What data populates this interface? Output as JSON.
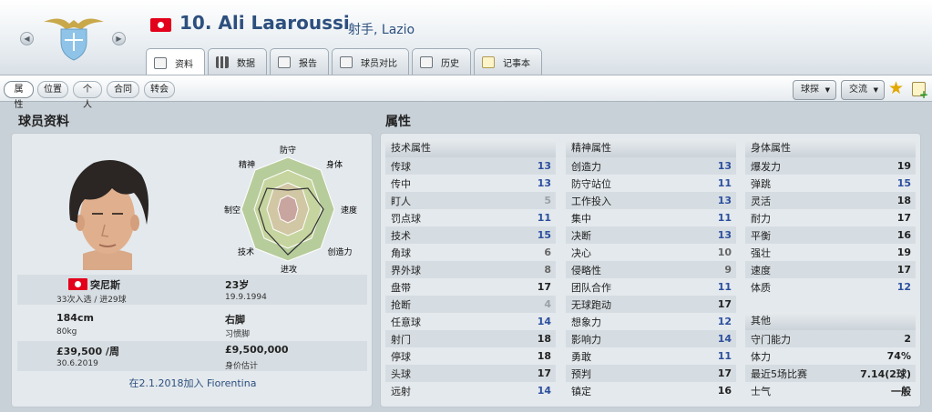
{
  "header": {
    "name": "10. Ali Laaroussi",
    "subtitle": "射手, Lazio"
  },
  "tabs": [
    {
      "label": "资料",
      "icon": "profile-icon"
    },
    {
      "label": "数据",
      "icon": "stats-icon"
    },
    {
      "label": "报告",
      "icon": "report-icon"
    },
    {
      "label": "球员对比",
      "icon": "compare-icon"
    },
    {
      "label": "历史",
      "icon": "history-icon"
    },
    {
      "label": "记事本",
      "icon": "notebook-icon"
    }
  ],
  "subtabs": [
    "属性",
    "位置",
    "个人",
    "合同",
    "转会"
  ],
  "toolbar": {
    "scout_label": "球探",
    "interact_label": "交流"
  },
  "profile": {
    "title": "球员资料",
    "radar_labels": [
      "防守",
      "身体",
      "速度",
      "创造力",
      "进攻",
      "技术",
      "制空",
      "精神"
    ],
    "nationality": "突尼斯",
    "caps": "33次入选 / 进29球",
    "age": "23岁",
    "dob": "19.9.1994",
    "height": "184cm",
    "weight": "80kg",
    "foot": "右脚",
    "foot_label": "习惯脚",
    "wage": "£39,500 /周",
    "contract_end": "30.6.2019",
    "value": "£9,500,000",
    "value_label": "身价估计",
    "joined": "在2.1.2018加入 Fiorentina"
  },
  "attributes": {
    "title": "属性",
    "technical": {
      "header": "技术属性",
      "rows": [
        [
          "传球",
          "13"
        ],
        [
          "传中",
          "13"
        ],
        [
          "盯人",
          "5"
        ],
        [
          "罚点球",
          "11"
        ],
        [
          "技术",
          "15"
        ],
        [
          "角球",
          "6"
        ],
        [
          "界外球",
          "8"
        ],
        [
          "盘带",
          "17"
        ],
        [
          "抢断",
          "4"
        ],
        [
          "任意球",
          "14"
        ],
        [
          "射门",
          "18"
        ],
        [
          "停球",
          "18"
        ],
        [
          "头球",
          "17"
        ],
        [
          "远射",
          "14"
        ]
      ]
    },
    "mental": {
      "header": "精神属性",
      "rows": [
        [
          "创造力",
          "13"
        ],
        [
          "防守站位",
          "11"
        ],
        [
          "工作投入",
          "13"
        ],
        [
          "集中",
          "11"
        ],
        [
          "决断",
          "13"
        ],
        [
          "决心",
          "10"
        ],
        [
          "侵略性",
          "9"
        ],
        [
          "团队合作",
          "11"
        ],
        [
          "无球跑动",
          "17"
        ],
        [
          "想象力",
          "12"
        ],
        [
          "影响力",
          "14"
        ],
        [
          "勇敢",
          "11"
        ],
        [
          "预判",
          "17"
        ],
        [
          "镇定",
          "16"
        ]
      ]
    },
    "physical": {
      "header": "身体属性",
      "rows": [
        [
          "爆发力",
          "19"
        ],
        [
          "弹跳",
          "15"
        ],
        [
          "灵活",
          "18"
        ],
        [
          "耐力",
          "17"
        ],
        [
          "平衡",
          "16"
        ],
        [
          "强壮",
          "19"
        ],
        [
          "速度",
          "17"
        ],
        [
          "体质",
          "12"
        ]
      ]
    },
    "other": {
      "header": "其他",
      "rows": [
        [
          "守门能力",
          "2"
        ],
        [
          "体力",
          "74%"
        ],
        [
          "最近5场比赛",
          "7.14(2球)"
        ],
        [
          "士气",
          "一般"
        ]
      ]
    }
  },
  "colors": {
    "accent": "#2c4f7e",
    "flag": "#e3001b",
    "star": "#e2a800"
  }
}
